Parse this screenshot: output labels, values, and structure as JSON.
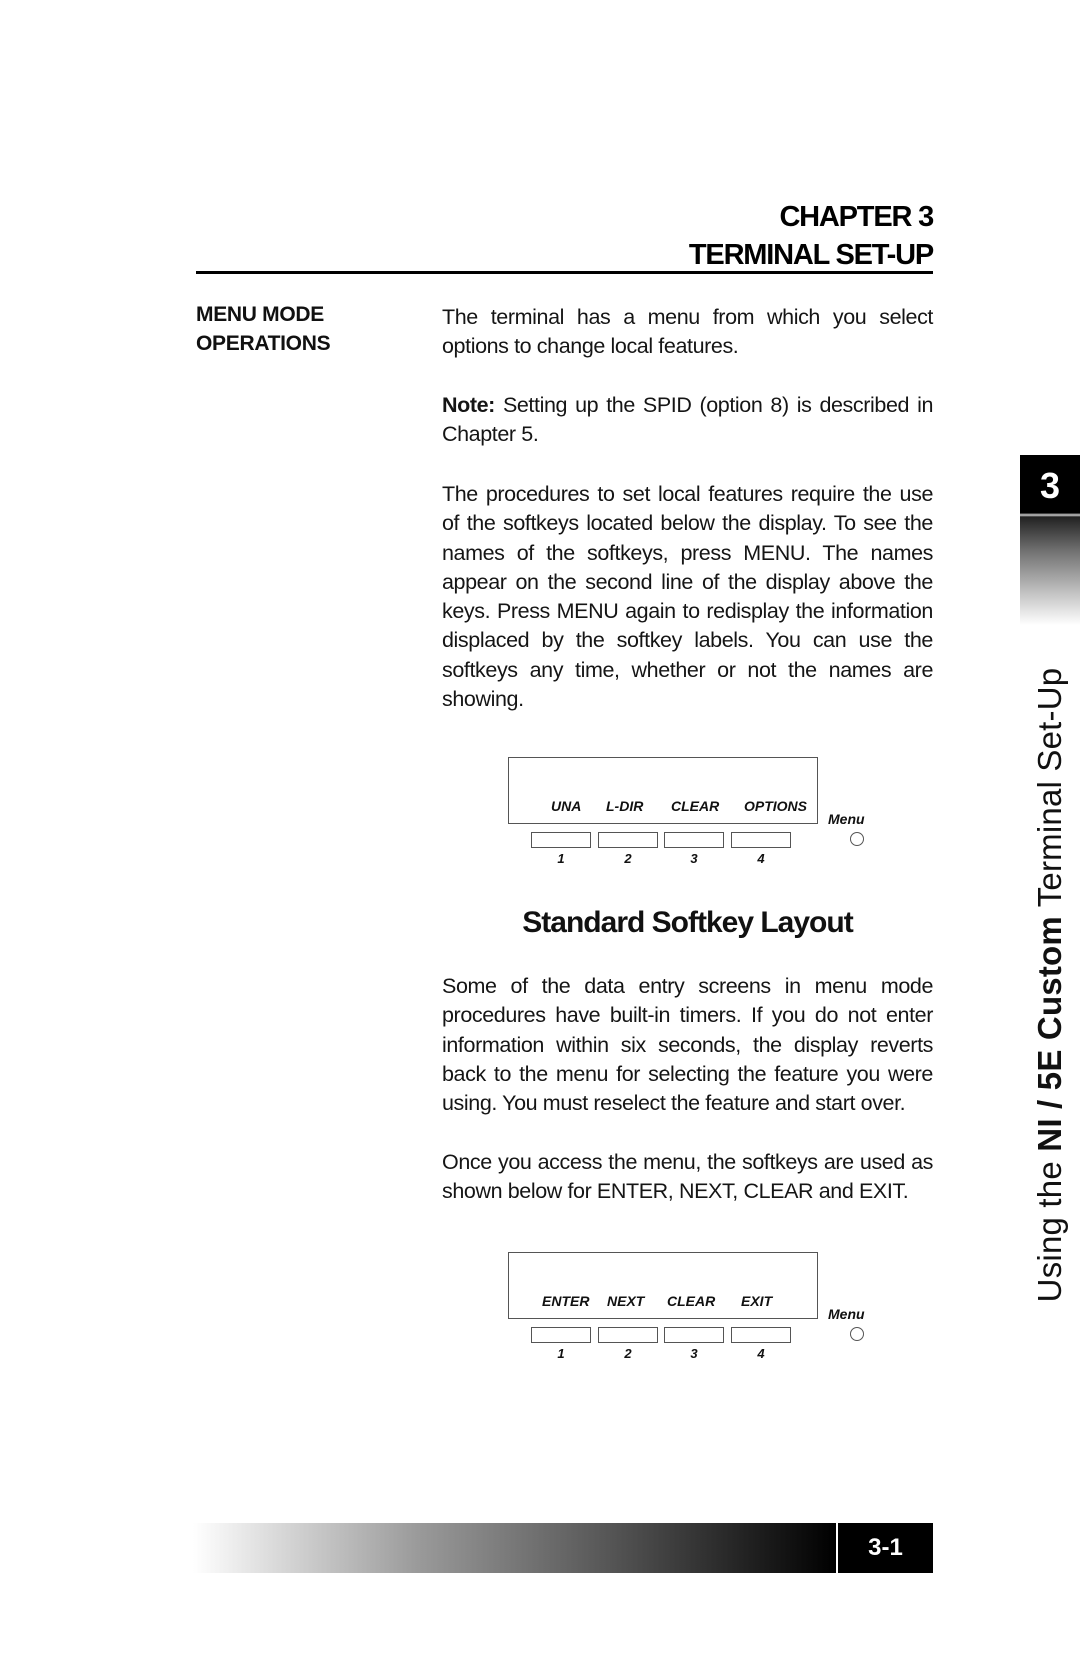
{
  "header": {
    "chapter_number": "CHAPTER 3",
    "chapter_title": "TERMINAL SET-UP"
  },
  "section": {
    "side_heading_line1": "MENU MODE",
    "side_heading_line2": "OPERATIONS"
  },
  "body": {
    "p1": "The terminal has a menu from which you select options to change local features.",
    "note_label": "Note:",
    "note_text": " Setting up the SPID (option 8) is described in Chapter 5.",
    "p3": "The procedures to set local features require the use of the softkeys located below the display.  To see the names of the softkeys, press MENU.  The names appear on the second line of the display above the keys.  Press MENU again to redisplay the information displaced by the softkey labels.  You can use the softkeys any time, whether or not the names are showing.",
    "p4": "Some of the data entry screens in menu mode procedures have built-in timers.  If you do not enter information within six seconds, the display reverts back to the menu for selecting the feature you were using.  You must reselect the feature and start over.",
    "p5": "Once you access the menu, the softkeys are used as shown below for ENTER, NEXT, CLEAR and EXIT."
  },
  "diagram1": {
    "softkey_labels": [
      "UNA",
      "L-DIR",
      "CLEAR",
      "OPTIONS"
    ],
    "key_numbers": [
      "1",
      "2",
      "3",
      "4"
    ],
    "menu_label": "Menu"
  },
  "caption": "Standard Softkey Layout",
  "diagram2": {
    "softkey_labels": [
      "ENTER",
      "NEXT",
      "CLEAR",
      "EXIT"
    ],
    "key_numbers": [
      "1",
      "2",
      "3",
      "4"
    ],
    "menu_label": "Menu"
  },
  "side_tab": {
    "number": "3",
    "text_prefix": "Using the ",
    "text_bold": "NI / 5E Custom",
    "text_suffix": " Terminal Set-Up"
  },
  "footer": {
    "page_number": "3-1"
  }
}
